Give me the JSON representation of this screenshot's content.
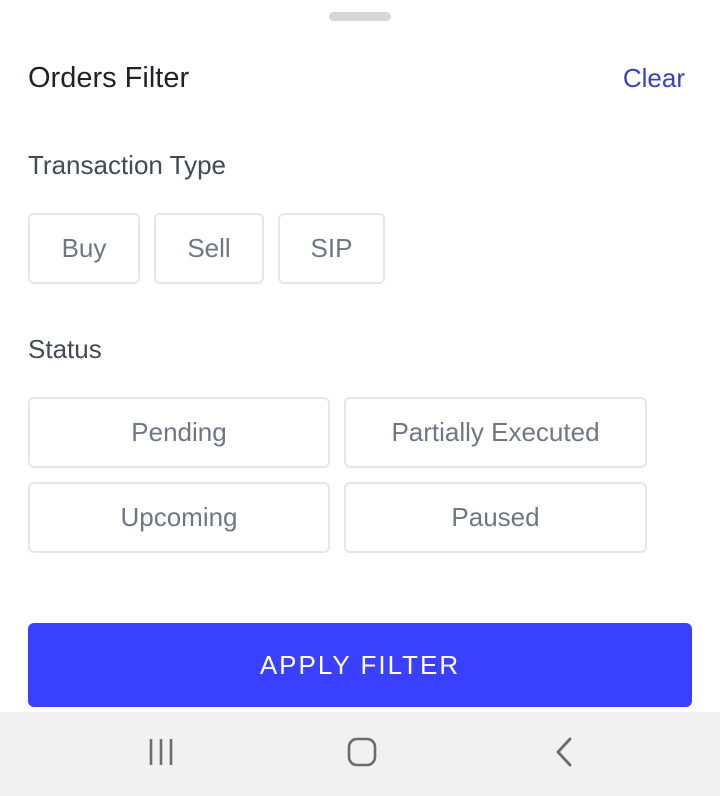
{
  "header": {
    "title": "Orders Filter",
    "clear_label": "Clear"
  },
  "transaction_type": {
    "label": "Transaction Type",
    "options": [
      "Buy",
      "Sell",
      "SIP"
    ]
  },
  "status": {
    "label": "Status",
    "options": [
      "Pending",
      "Partially Executed",
      "Upcoming",
      "Paused"
    ]
  },
  "apply_button": {
    "label": "APPLY FILTER"
  },
  "navbar": {
    "icons": [
      "recent-apps-icon",
      "home-icon",
      "back-icon"
    ]
  },
  "colors": {
    "accent": "#3a40ff",
    "link": "#3a3fc4",
    "chip_border": "#e4e6e9",
    "chip_text": "#6e7783",
    "navbar_bg": "#f1f1f1"
  }
}
